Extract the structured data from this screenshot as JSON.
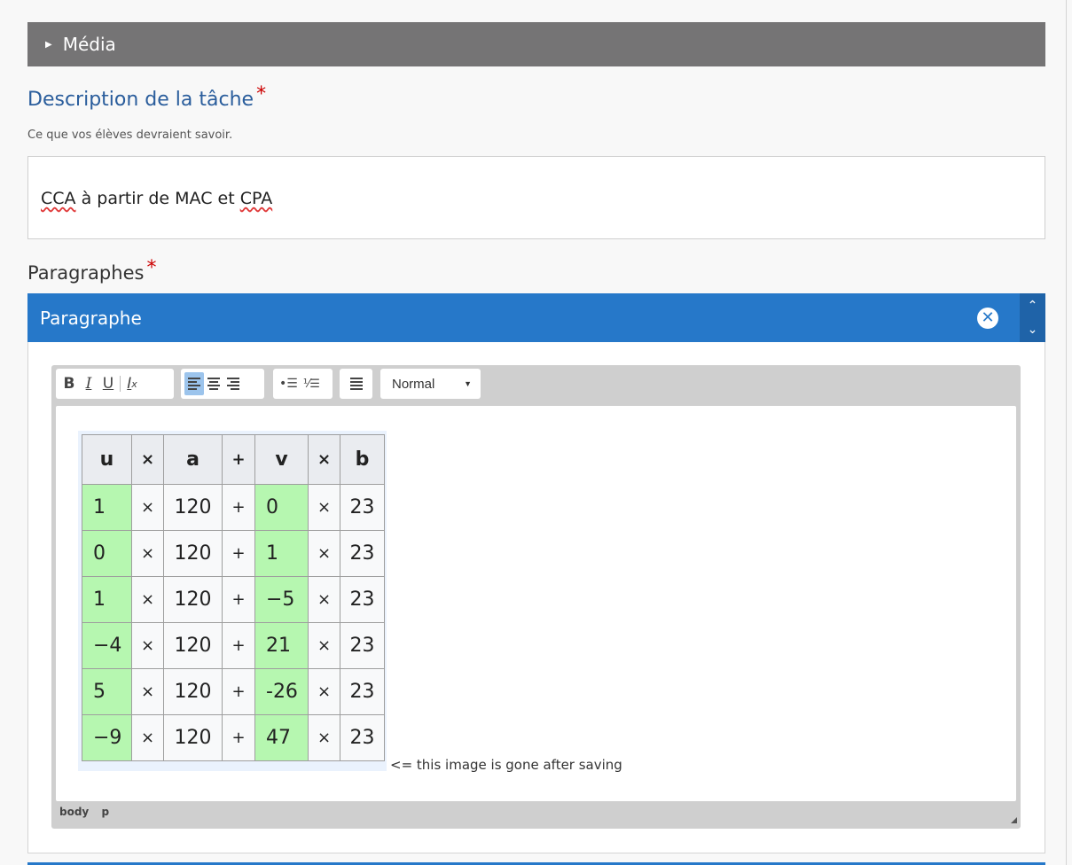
{
  "media": {
    "label": "Média"
  },
  "description": {
    "title": "Description de la tâche",
    "required_mark": "*",
    "help": "Ce que vos élèves devraient savoir.",
    "value_parts": [
      "CCA",
      " à partir de MAC et ",
      "CPA"
    ]
  },
  "paragraphs": {
    "title": "Paragraphes",
    "required_mark": "*",
    "item_title": "Paragraphe",
    "remove_icon": "✖",
    "move_up_icon": "⌃",
    "move_down_icon": "⌄"
  },
  "toolbar": {
    "bold": "B",
    "italic": "I",
    "underline": "U",
    "clear_format": "Ix",
    "format_select": "Normal"
  },
  "content": {
    "table_headers": [
      "u",
      "×",
      "a",
      "+",
      "v",
      "×",
      "b"
    ],
    "table_rows": [
      [
        "1",
        "×",
        "120",
        "+",
        "0",
        "×",
        "23"
      ],
      [
        "0",
        "×",
        "120",
        "+",
        "1",
        "×",
        "23"
      ],
      [
        "1",
        "×",
        "120",
        "+",
        "−5",
        "×",
        "23"
      ],
      [
        "−4",
        "×",
        "120",
        "+",
        "21",
        "×",
        "23"
      ],
      [
        "5",
        "×",
        "120",
        "+",
        "-26",
        "×",
        "23"
      ],
      [
        "−9",
        "×",
        "120",
        "+",
        "47",
        "×",
        "23"
      ]
    ],
    "note": "<= this image is gone after saving"
  },
  "pathbar": {
    "items": [
      "body",
      "p"
    ]
  },
  "colors": {
    "header_blue": "#2678c9",
    "media_gray": "#757475",
    "title_blue": "#2a5d9c",
    "highlight_green": "#b6f7b0"
  }
}
